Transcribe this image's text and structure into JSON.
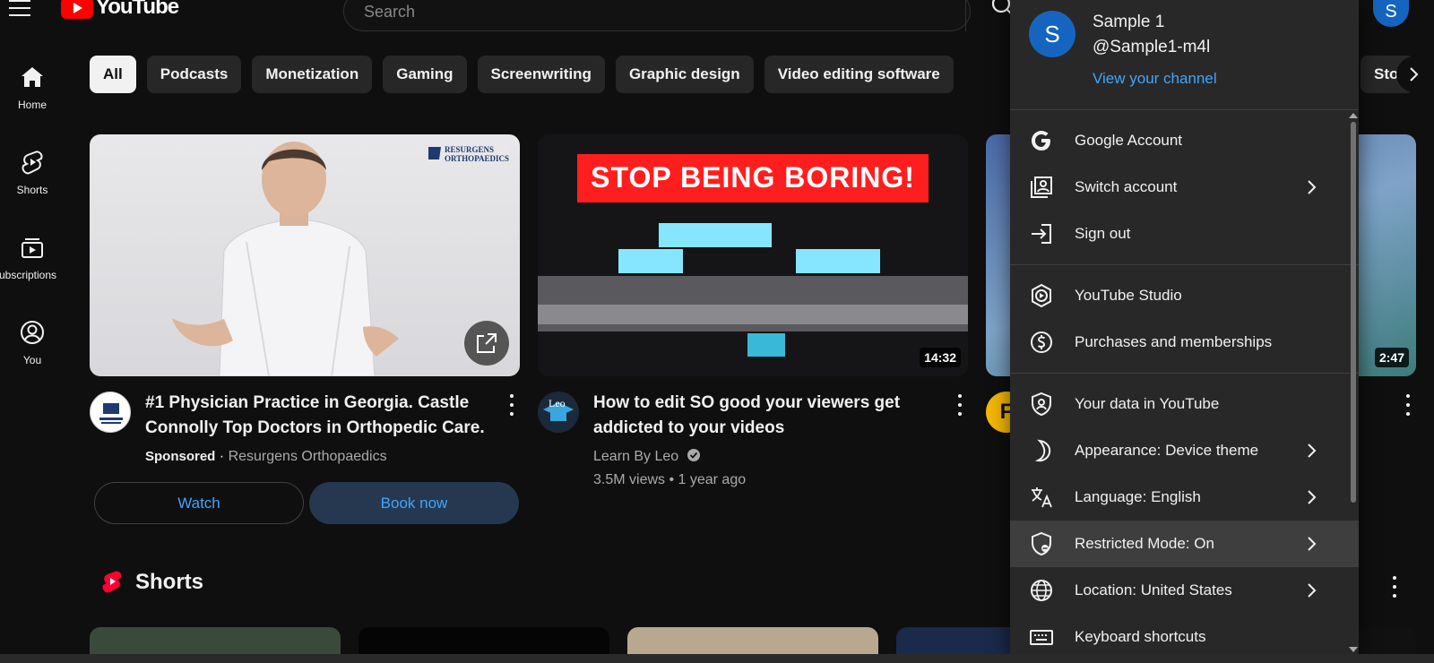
{
  "header": {
    "logo_text": "YouTube",
    "search_placeholder": "Search",
    "avatar_letter": "S"
  },
  "leftnav": [
    {
      "label": "Home",
      "icon": "home-icon"
    },
    {
      "label": "Shorts",
      "icon": "shorts-icon"
    },
    {
      "label": "Subscriptions",
      "icon": "subscriptions-icon"
    },
    {
      "label": "You",
      "icon": "you-icon"
    }
  ],
  "chips": [
    "All",
    "Podcasts",
    "Monetization",
    "Gaming",
    "Screenwriting",
    "Graphic design",
    "Video editing software"
  ],
  "chip_right": "Sto",
  "videos": [
    {
      "title_line1": "#1 Physician Practice in Georgia. Castle",
      "title_line2": "Connolly Top Doctors in Orthopedic Care.",
      "sponsored": "Sponsored",
      "channel": "Resurgens Orthopaedics",
      "thumb_logo_top": "RESURGENS",
      "thumb_logo_bottom": "ORTHOPAEDICS",
      "watch_label": "Watch",
      "book_label": "Book now"
    },
    {
      "title_line1": "How to edit SO good your viewers get",
      "title_line2": "addicted to your videos",
      "channel": "Learn By Leo",
      "stats": "3.5M views • 1 year ago",
      "duration": "14:32",
      "thumb_banner": "STOP BEING BORING!",
      "avatar_text": "Leo"
    },
    {
      "duration": "2:47",
      "avatar_letter": "F"
    }
  ],
  "shorts": {
    "title": "Shorts"
  },
  "account_menu": {
    "avatar_letter": "S",
    "name": "Sample 1",
    "handle": "@Sample1-m4l",
    "view_channel": "View your channel",
    "sections": [
      [
        {
          "label": "Google Account",
          "icon": "google-icon",
          "chevron": false
        },
        {
          "label": "Switch account",
          "icon": "switch-account-icon",
          "chevron": true
        },
        {
          "label": "Sign out",
          "icon": "sign-out-icon",
          "chevron": false
        }
      ],
      [
        {
          "label": "YouTube Studio",
          "icon": "studio-icon",
          "chevron": false
        },
        {
          "label": "Purchases and memberships",
          "icon": "purchases-icon",
          "chevron": false
        }
      ],
      [
        {
          "label": "Your data in YouTube",
          "icon": "data-shield-icon",
          "chevron": false
        },
        {
          "label": "Appearance: Device theme",
          "icon": "moon-icon",
          "chevron": true
        },
        {
          "label": "Language: English",
          "icon": "language-icon",
          "chevron": true
        },
        {
          "label": "Restricted Mode: On",
          "icon": "restricted-icon",
          "chevron": true
        },
        {
          "label": "Location: United States",
          "icon": "globe-icon",
          "chevron": true
        },
        {
          "label": "Keyboard shortcuts",
          "icon": "keyboard-icon",
          "chevron": false
        }
      ]
    ]
  },
  "colors": {
    "background": "#0f0f0f",
    "menu_bg": "#282828",
    "accent_link": "#3ea6ff",
    "brand_red": "#ff0000",
    "avatar_blue": "#1565c0"
  }
}
